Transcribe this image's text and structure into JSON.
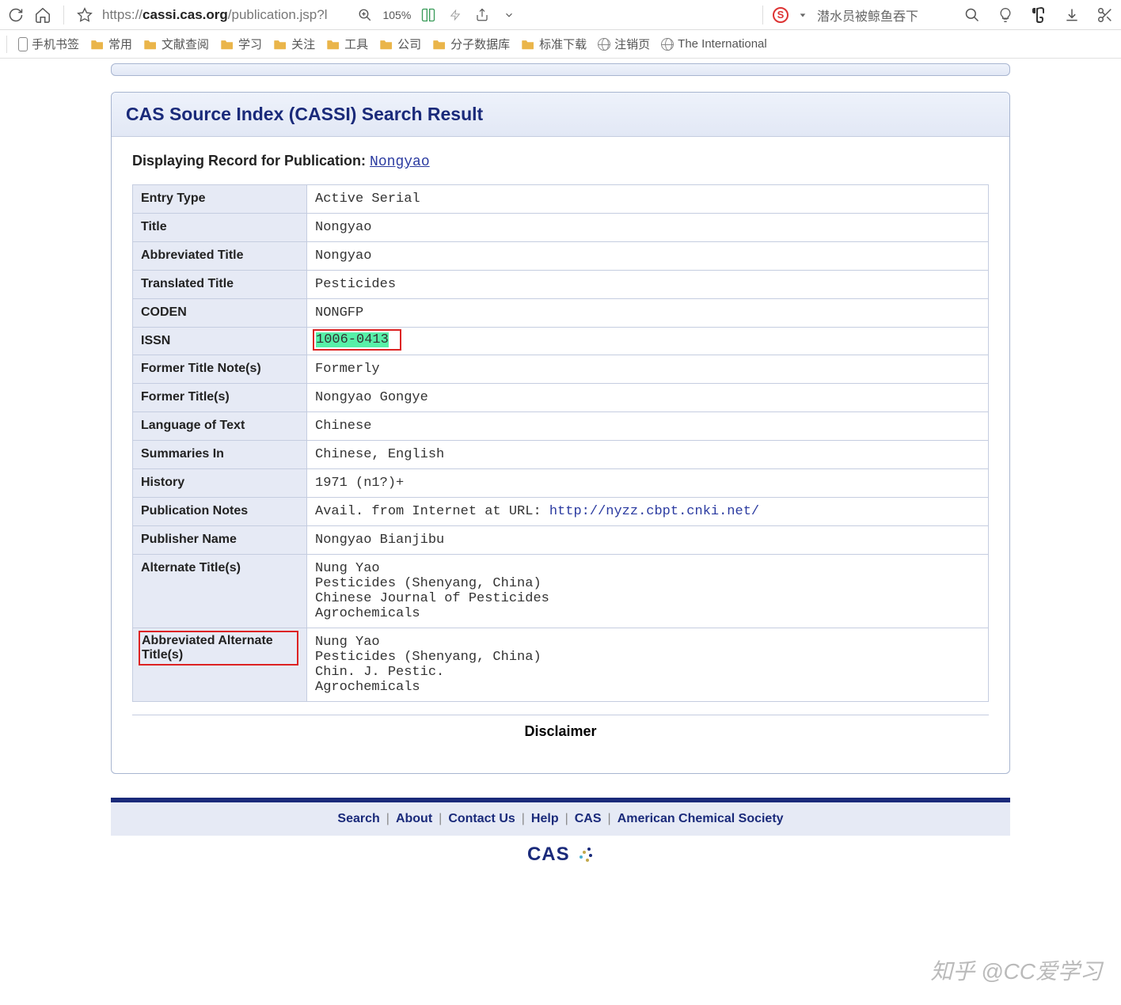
{
  "browser": {
    "url_proto": "https://",
    "url_host": "cassi.cas.org",
    "url_path": "/publication.jsp?l",
    "zoom": "105%",
    "search_value": "潜水员被鲸鱼吞下"
  },
  "bookmarks": {
    "items": [
      {
        "label": "手机书签",
        "type": "phone"
      },
      {
        "label": "常用",
        "type": "folder"
      },
      {
        "label": "文献查阅",
        "type": "folder"
      },
      {
        "label": "学习",
        "type": "folder"
      },
      {
        "label": "关注",
        "type": "folder"
      },
      {
        "label": "工具",
        "type": "folder"
      },
      {
        "label": "公司",
        "type": "folder"
      },
      {
        "label": "分子数据库",
        "type": "folder"
      },
      {
        "label": "标准下载",
        "type": "folder"
      },
      {
        "label": "注销页",
        "type": "globe"
      },
      {
        "label": "The International",
        "type": "globe"
      }
    ]
  },
  "result": {
    "title": "CAS Source Index (CASSI) Search Result",
    "displaying_prefix": "Displaying Record for Publication: ",
    "publication_link": "Nongyao",
    "rows": [
      {
        "key": "Entry Type",
        "val": "Active Serial"
      },
      {
        "key": "Title",
        "val": "Nongyao"
      },
      {
        "key": "Abbreviated Title",
        "val": "Nongyao"
      },
      {
        "key": "Translated Title",
        "val": "Pesticides"
      },
      {
        "key": "CODEN",
        "val": "NONGFP"
      },
      {
        "key": "ISSN",
        "val": "1006-0413"
      },
      {
        "key": "Former Title Note(s)",
        "val": "Formerly"
      },
      {
        "key": "Former Title(s)",
        "val": "Nongyao Gongye"
      },
      {
        "key": "Language of Text",
        "val": "Chinese"
      },
      {
        "key": "Summaries In",
        "val": "Chinese, English"
      },
      {
        "key": "History",
        "val": "1971 (n1?)+"
      },
      {
        "key": "Publication Notes",
        "val": "Avail. from Internet at URL: ",
        "url": "http://nyzz.cbpt.cnki.net/"
      },
      {
        "key": "Publisher Name",
        "val": "Nongyao Bianjibu"
      },
      {
        "key": "Alternate Title(s)",
        "lines": [
          "Nung Yao",
          "Pesticides (Shenyang, China)",
          "Chinese Journal of Pesticides",
          "Agrochemicals"
        ]
      },
      {
        "key": "Abbreviated Alternate Title(s)",
        "lines": [
          "Nung Yao",
          "Pesticides (Shenyang, China)",
          "Chin. J. Pestic.",
          "Agrochemicals"
        ]
      }
    ],
    "disclaimer": "Disclaimer"
  },
  "footer": {
    "links": [
      "Search",
      "About",
      "Contact Us",
      "Help",
      "CAS",
      "American Chemical Society"
    ],
    "logo": "CAS"
  },
  "watermark": "知乎 @CC爱学习"
}
